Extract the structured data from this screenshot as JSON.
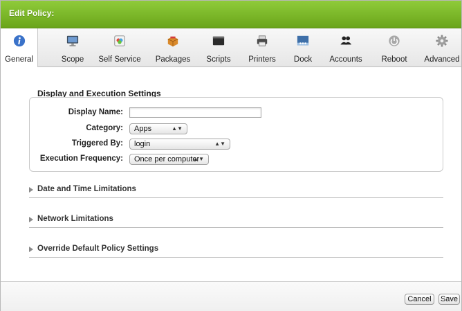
{
  "window": {
    "title": "Edit Policy:"
  },
  "tabs": [
    {
      "label": "General",
      "icon": "info-icon"
    },
    {
      "label": "Scope",
      "icon": "monitor-icon"
    },
    {
      "label": "Self Service",
      "icon": "self-service-icon"
    },
    {
      "label": "Packages",
      "icon": "package-icon"
    },
    {
      "label": "Scripts",
      "icon": "script-icon"
    },
    {
      "label": "Printers",
      "icon": "printer-icon"
    },
    {
      "label": "Dock",
      "icon": "dock-icon"
    },
    {
      "label": "Accounts",
      "icon": "accounts-icon"
    },
    {
      "label": "Reboot",
      "icon": "reboot-icon"
    },
    {
      "label": "Advanced",
      "icon": "gear-icon"
    }
  ],
  "active_tab": "General",
  "display_section": {
    "title": "Display and Execution Settings",
    "display_name": {
      "label": "Display Name:",
      "value": ""
    },
    "category": {
      "label": "Category:",
      "value": "Apps"
    },
    "triggered_by": {
      "label": "Triggered By:",
      "value": "login"
    },
    "execution_frequency": {
      "label": "Execution Frequency:",
      "value": "Once per computer"
    }
  },
  "collapsibles": [
    {
      "label": "Date and Time Limitations"
    },
    {
      "label": "Network Limitations"
    },
    {
      "label": "Override Default Policy Settings"
    }
  ],
  "footer": {
    "cancel_label": "Cancel",
    "save_label": "Save"
  },
  "colors": {
    "titlebar": "#7bb82a",
    "info_icon": "#3a72c9"
  }
}
